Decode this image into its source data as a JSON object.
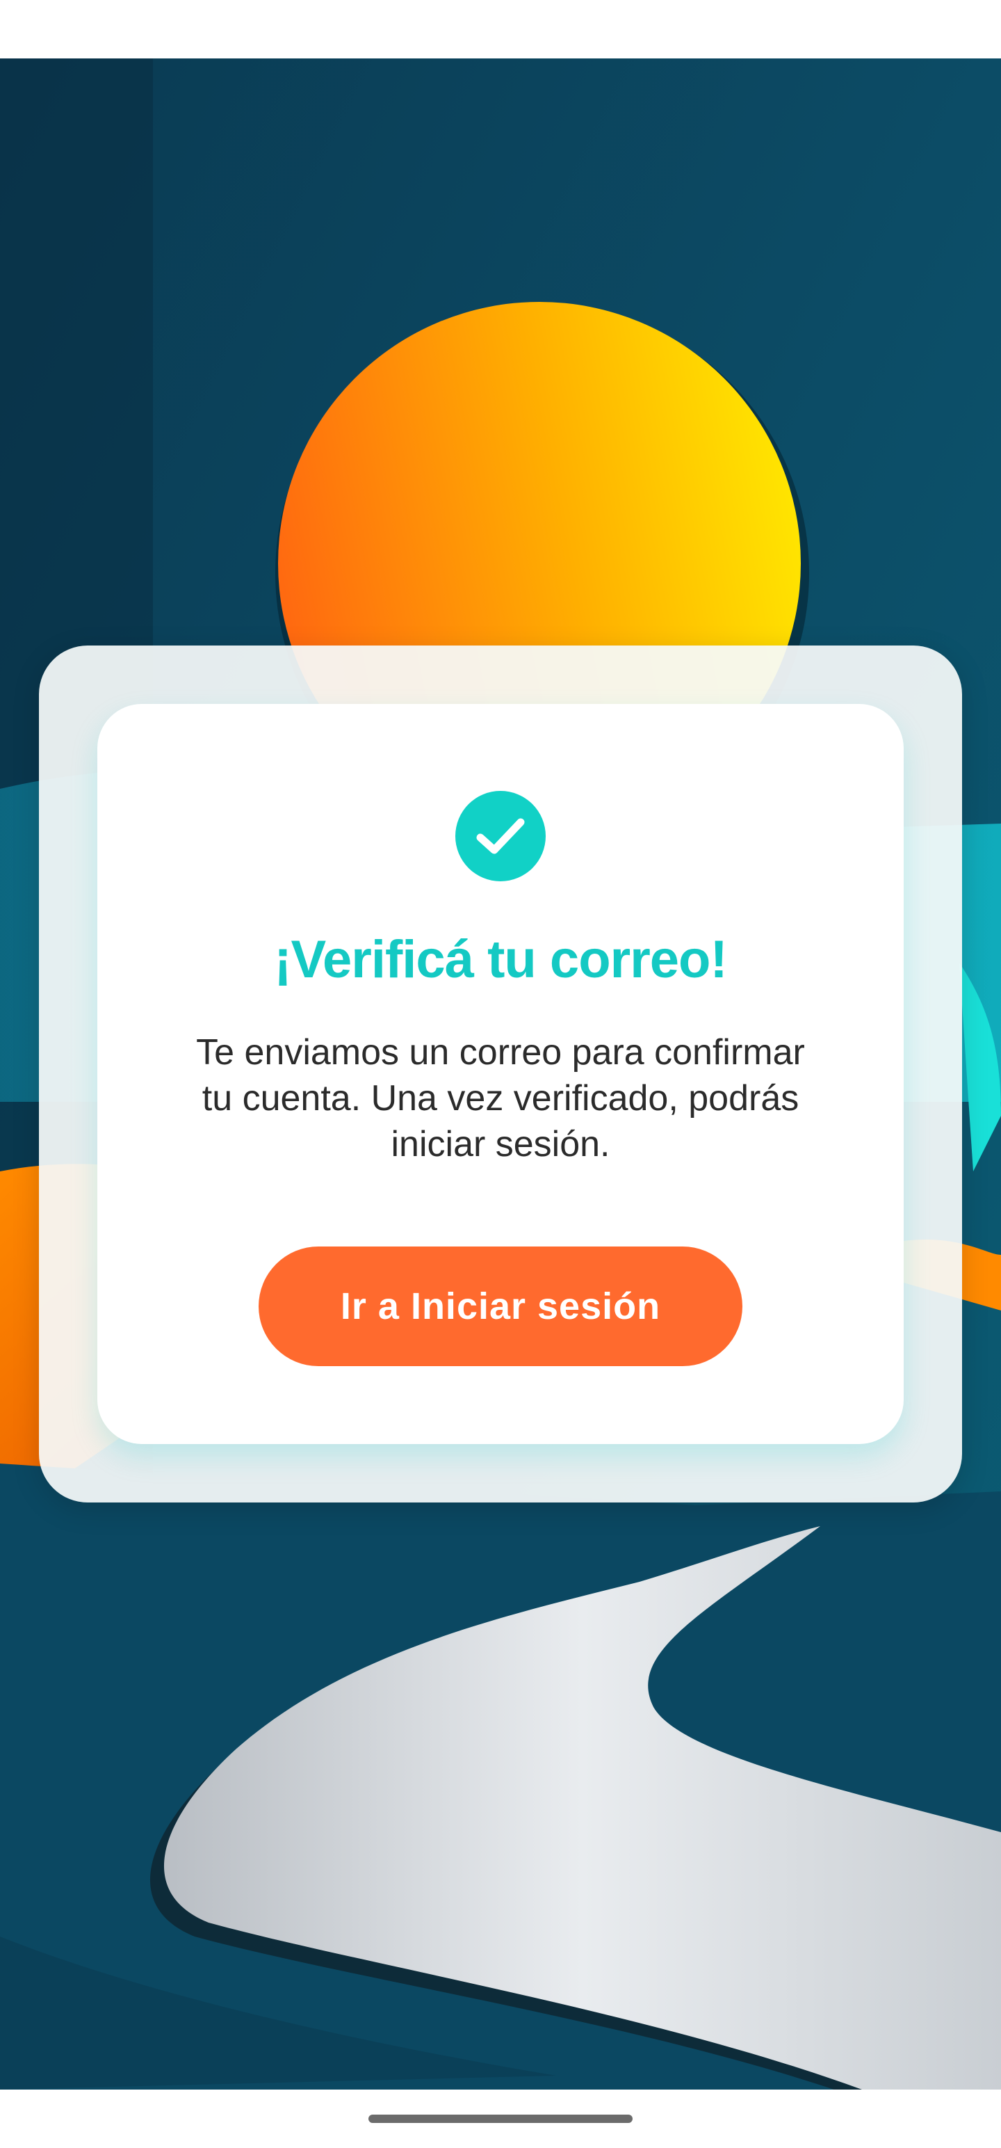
{
  "screen": {
    "accent_color": "#14c9c3",
    "button_color": "#ff6a2e"
  },
  "background": {
    "icon": "sunset-landscape-illustration"
  },
  "dialog": {
    "icon": "check-circle-icon",
    "title": "¡Verificá tu correo!",
    "message": "Te enviamos un correo para confirmar tu cuenta. Una vez verificado, podrás iniciar sesión.",
    "button_label": "Ir a Iniciar sesión"
  }
}
